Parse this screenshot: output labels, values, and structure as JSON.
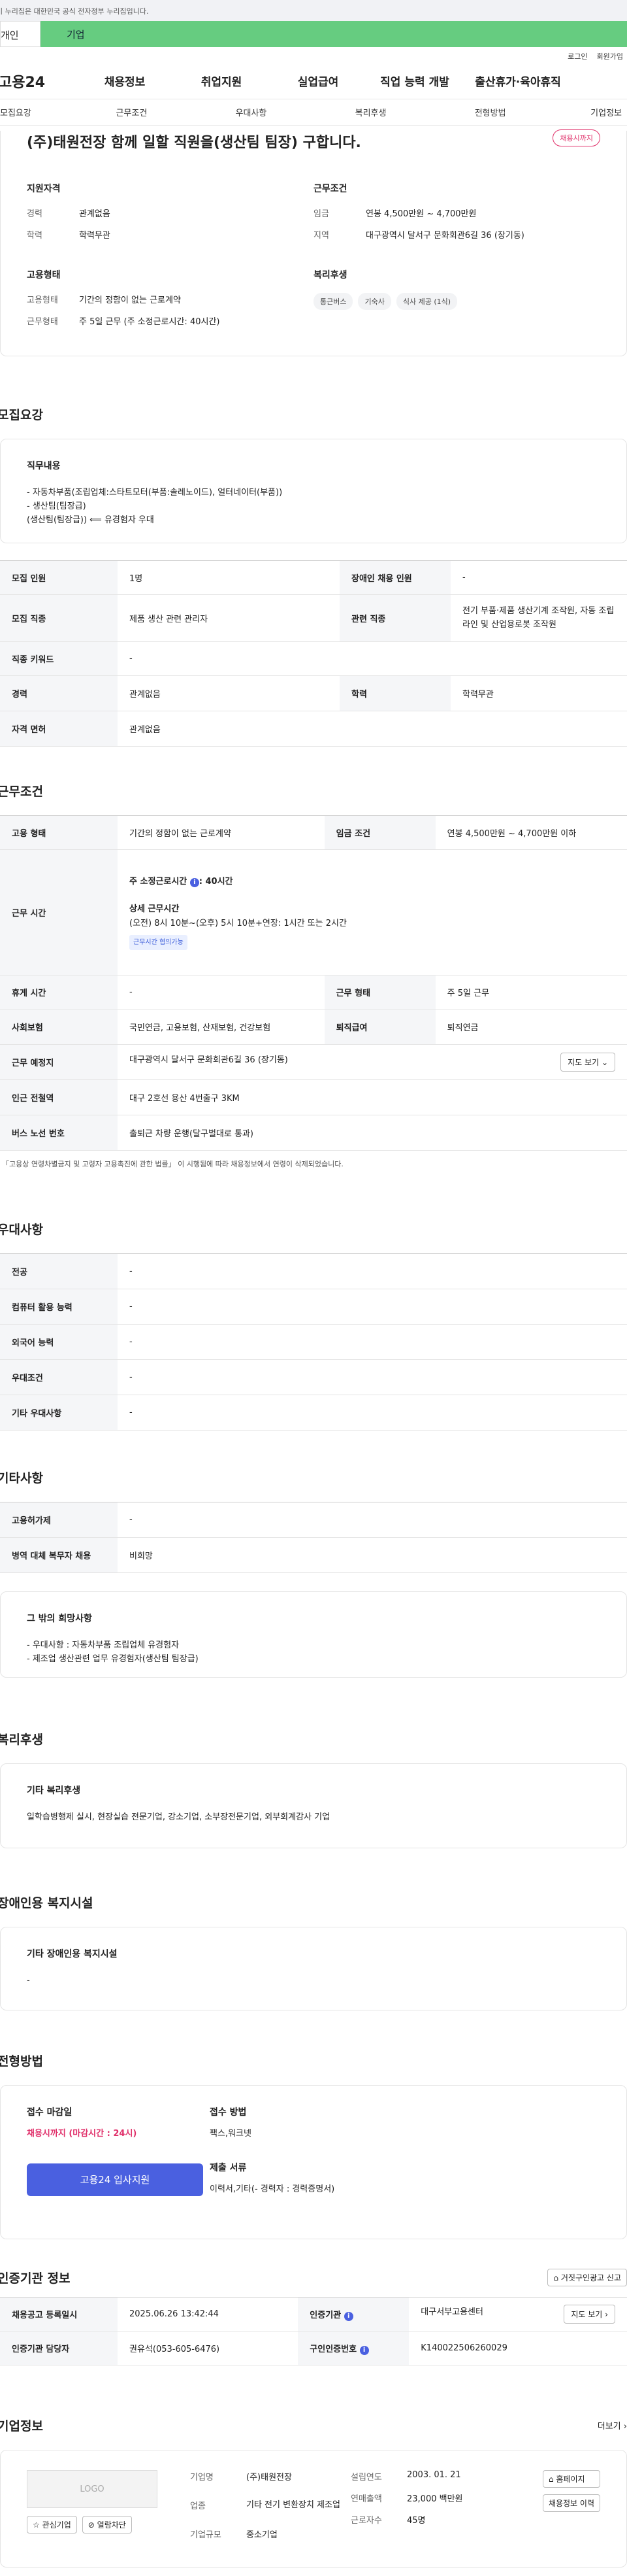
{
  "gov_banner": "이 누리집은 대한민국 공식 전자정부 누리집입니다.",
  "uni_tabs": [
    "개인",
    "기업"
  ],
  "util": [
    "로그인",
    "회원가입"
  ],
  "gnb": {
    "logo": "고용24",
    "menu": [
      "채용정보",
      "취업지원",
      "실업급여",
      "직업 능력 개발",
      "출산휴가·육아휴직"
    ]
  },
  "tabs": [
    "모집요강",
    "근무조건",
    "우대사항",
    "복리후생",
    "전형방법",
    "기업정보"
  ],
  "head": {
    "title": "(주)태원전장 함께 일할 직원을(생산팀 팀장) 구합니다.",
    "badge": "채용시까지",
    "left_title": "지원자격",
    "right_title": "근무조건",
    "left": [
      {
        "k": "경력",
        "v": "관계없음"
      },
      {
        "k": "학력",
        "v": "학력무관"
      }
    ],
    "right": [
      {
        "k": "임금",
        "v": "연봉 4,500만원 ~ 4,700만원"
      },
      {
        "k": "지역",
        "v": "대구광역시 달서구 문화회관6길 36 (장기동)"
      }
    ],
    "emp_title": "고용형태",
    "emp": [
      {
        "k": "고용형태",
        "v": "기간의 정함이 없는 근로계약"
      },
      {
        "k": "근무형태",
        "v": "주 5일 근무 (주 소정근로시간: 40시간)"
      }
    ],
    "welfare_title": "복리후생",
    "chips": [
      "통근버스",
      "기숙사",
      "식사 제공 (1식)"
    ]
  },
  "recruit": {
    "title": "모집요강",
    "box_title": "직무내용",
    "box_lines": [
      "- 자동차부품(조립업체:스타트모터(부품:솔레노이드), 얼터네이터(부품))",
      "- 생산팀(팀장급)",
      "(생산팀(팀장급)) ⟸ 유경험자 우대"
    ],
    "rows": [
      [
        "모집 인원",
        "1명",
        "장애인 채용 인원",
        "-"
      ],
      [
        "모집 직종",
        "제품 생산 관련 관리자",
        "관련 직종",
        "전기 부품·제품 생산기계 조작원, 자동 조립 라인 및 산업용로봇 조작원"
      ],
      [
        "직종 키워드",
        "-"
      ],
      [
        "경력",
        "관계없음",
        "학력",
        "학력무관"
      ],
      [
        "자격 면허",
        "관계없음"
      ]
    ]
  },
  "cond": {
    "title": "근무조건",
    "row1": [
      "고용 형태",
      "기간의 정함이 없는 근로계약",
      "임금 조건",
      "연봉 4,500만원 ~ 4,700만원 이하"
    ],
    "hours_h": "근무 시간",
    "hours_main": "주 소정근로시간",
    "hours_val": ": 40시간",
    "hours_sub": "상세 근무시간",
    "hours_detail": "(오전) 8시 10분~(오후) 5시 10분+연장: 1시간 또는 2시간",
    "hours_tag": "근무시간 협의가능",
    "rows": [
      [
        "휴게 시간",
        "-",
        "근무 형태",
        "주 5일 근무"
      ],
      [
        "사회보험",
        "국민연금, 고용보험, 산재보험, 건강보험",
        "퇴직급여",
        "퇴직연금"
      ]
    ],
    "place_h": "근무 예정지",
    "place": "대구광역시 달서구 문화회관6길 36 (장기동)",
    "map_btn": "지도 보기",
    "station_h": "인근 전철역",
    "station": "대구 2호선 용산 4번출구 3KM",
    "bus_h": "버스 노선 번호",
    "bus": "출퇴근 차량 운행(달구벌대로 통과)",
    "note": "* 「고용상 연령차별금지 및 고령자 고용촉진에 관한 법률」 이 시행됨에 따라 채용정보에서 연령이 삭제되었습니다."
  },
  "pref": {
    "title": "우대사항",
    "rows": [
      [
        "전공",
        "-"
      ],
      [
        "컴퓨터 활용 능력",
        "-"
      ],
      [
        "외국어 능력",
        "-"
      ],
      [
        "우대조건",
        "-"
      ],
      [
        "기타 우대사항",
        "-"
      ]
    ]
  },
  "etc": {
    "title": "기타사항",
    "rows": [
      [
        "고용허가제",
        "-"
      ],
      [
        "병역 대체 복무자 채용",
        "비희망"
      ]
    ],
    "box_title": "그 밖의 희망사항",
    "box_lines": [
      "- 우대사항 : 자동차부품 조립업체 유경험자",
      "- 제조업 생산관련 업무 유경험자(생산팀 팀장급)"
    ]
  },
  "welfare": {
    "title": "복리후생",
    "box_title": "기타 복리후생",
    "box_text": "일학습병행제 실시, 현장실습 전문기업, 강소기업, 소부장전문기업, 외부회계감사 기업"
  },
  "disab": {
    "title": "장애인용 복지시설",
    "box_title": "기타 장애인용 복지시설",
    "box_text": "-"
  },
  "selection": {
    "title": "전형방법",
    "deadline_h": "접수 마감일",
    "deadline": "채용시까지 (마감시간 : 24시)",
    "apply_btn": "고용24 입사지원",
    "method_h": "접수 방법",
    "method": "팩스,워크넷",
    "docs_h": "제출 서류",
    "docs": "이력서,기타(- 경력자 : 경력증명서)"
  },
  "agency": {
    "title": "인증기관 정보",
    "report_btn": "거짓구인광고 신고",
    "rows": [
      [
        "채용공고 등록일시",
        "2025.06.26 13:42:44",
        "인증기관",
        "대구서부고용센터"
      ],
      [
        "인증기관 담당자",
        "권유석(053-605-6476)",
        "구인인증번호",
        "K140022506260029"
      ]
    ],
    "map_btn": "지도 보기"
  },
  "company": {
    "title": "기업정보",
    "more": "더보기",
    "logo": "LOGO",
    "btns": [
      "관심기업",
      "열람차단"
    ],
    "name_k": "기업명",
    "name": "(주)태원전장",
    "ind_k": "업종",
    "ind": "기타 전기 변환장치 제조업",
    "size_k": "기업규모",
    "size": "중소기업",
    "year_k": "설립연도",
    "year": "2003. 01. 21",
    "sales_k": "연매출액",
    "sales": "23,000 백만원",
    "emp_k": "근로자수",
    "emp": "45명",
    "home_btn": "홈페이지",
    "hist_btn": "채용정보 이력"
  }
}
